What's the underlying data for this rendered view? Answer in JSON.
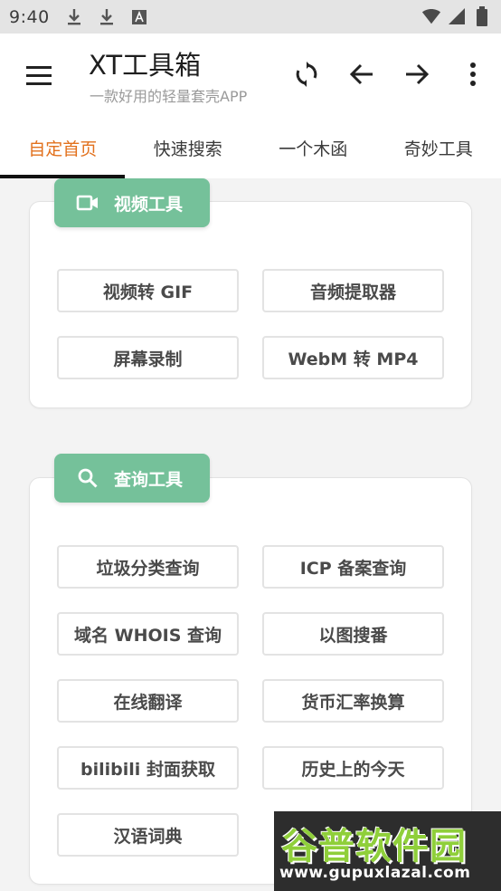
{
  "status_bar": {
    "time": "9:40",
    "left_icons": [
      "download-icon",
      "download-icon",
      "font-a-icon"
    ],
    "right_icons": [
      "wifi-icon",
      "signal-icon",
      "battery-icon"
    ]
  },
  "app_bar": {
    "title": "XT工具箱",
    "subtitle": "一款好用的轻量套壳APP",
    "actions": [
      "refresh-icon",
      "back-arrow-icon",
      "forward-arrow-icon",
      "more-vert-icon"
    ]
  },
  "tabs": [
    {
      "label": "自定首页",
      "active": true
    },
    {
      "label": "快速搜索",
      "active": false
    },
    {
      "label": "一个木函",
      "active": false
    },
    {
      "label": "奇妙工具",
      "active": false
    }
  ],
  "sections": [
    {
      "badge": "视频工具",
      "icon": "videocam-icon",
      "tools": [
        "视频转 GIF",
        "音频提取器",
        "屏幕录制",
        "WebM 转 MP4"
      ]
    },
    {
      "badge": "查询工具",
      "icon": "search-icon",
      "tools": [
        "垃圾分类查询",
        "ICP 备案查询",
        "域名 WHOIS 查询",
        "以图搜番",
        "在线翻译",
        "货币汇率换算",
        "bilibili 封面获取",
        "历史上的今天",
        "汉语词典"
      ]
    }
  ],
  "watermark": {
    "main": "谷普软件园",
    "url": "www.gupuxlazal.com"
  },
  "colors": {
    "accent_tab": "#e2711d",
    "badge_green": "#75c19a",
    "watermark_green": "#8fcf3a"
  }
}
